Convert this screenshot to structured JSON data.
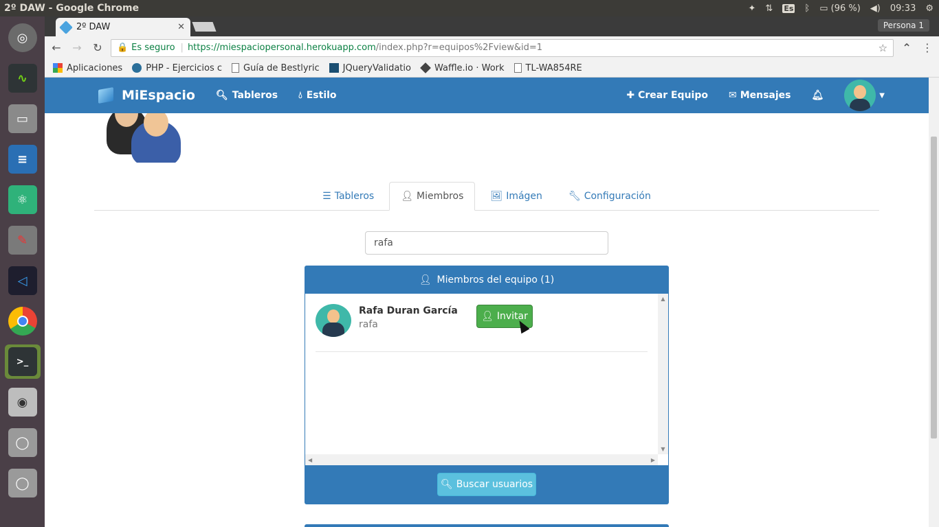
{
  "system": {
    "window_title": "2º DAW - Google Chrome",
    "lang": "Es",
    "battery": "(96 %)",
    "time": "09:33"
  },
  "browser": {
    "tab_title": "2º DAW",
    "profile": "Persona 1",
    "secure_label": "Es seguro",
    "url_scheme_host": "https://miespaciopersonal.herokuapp.com",
    "url_path": "/index.php?r=equipos%2Fview&id=1",
    "bookmarks": [
      {
        "label": "Aplicaciones"
      },
      {
        "label": "PHP - Ejercicios c"
      },
      {
        "label": "Guía de Bestlyric"
      },
      {
        "label": "JQueryValidatio"
      },
      {
        "label": "Waffle.io · Work"
      },
      {
        "label": "TL-WA854RE"
      }
    ]
  },
  "navbar": {
    "brand": "MiEspacio",
    "links": [
      {
        "label": "Tableros",
        "icon": "search-icon"
      },
      {
        "label": "Estilo",
        "icon": "tint-icon"
      }
    ],
    "right": [
      {
        "label": "Crear Equipo",
        "icon": "plus-icon"
      },
      {
        "label": "Mensajes",
        "icon": "envelope-icon"
      }
    ]
  },
  "tabs": [
    {
      "label": "Tableros",
      "icon": "list-icon",
      "active": false
    },
    {
      "label": "Miembros",
      "icon": "user-icon",
      "active": true
    },
    {
      "label": "Imágen",
      "icon": "picture-icon",
      "active": false
    },
    {
      "label": "Configuración",
      "icon": "wrench-icon",
      "active": false
    }
  ],
  "search": {
    "value": "rafa"
  },
  "panel": {
    "title": "Miembros del equipo (1)",
    "members": [
      {
        "name": "Rafa Duran García",
        "username": "rafa",
        "action_label": "Invitar"
      }
    ],
    "search_button": "Buscar usuarios"
  },
  "colors": {
    "primary": "#337ab7",
    "success": "#4cae4c",
    "info": "#5bc0de"
  }
}
